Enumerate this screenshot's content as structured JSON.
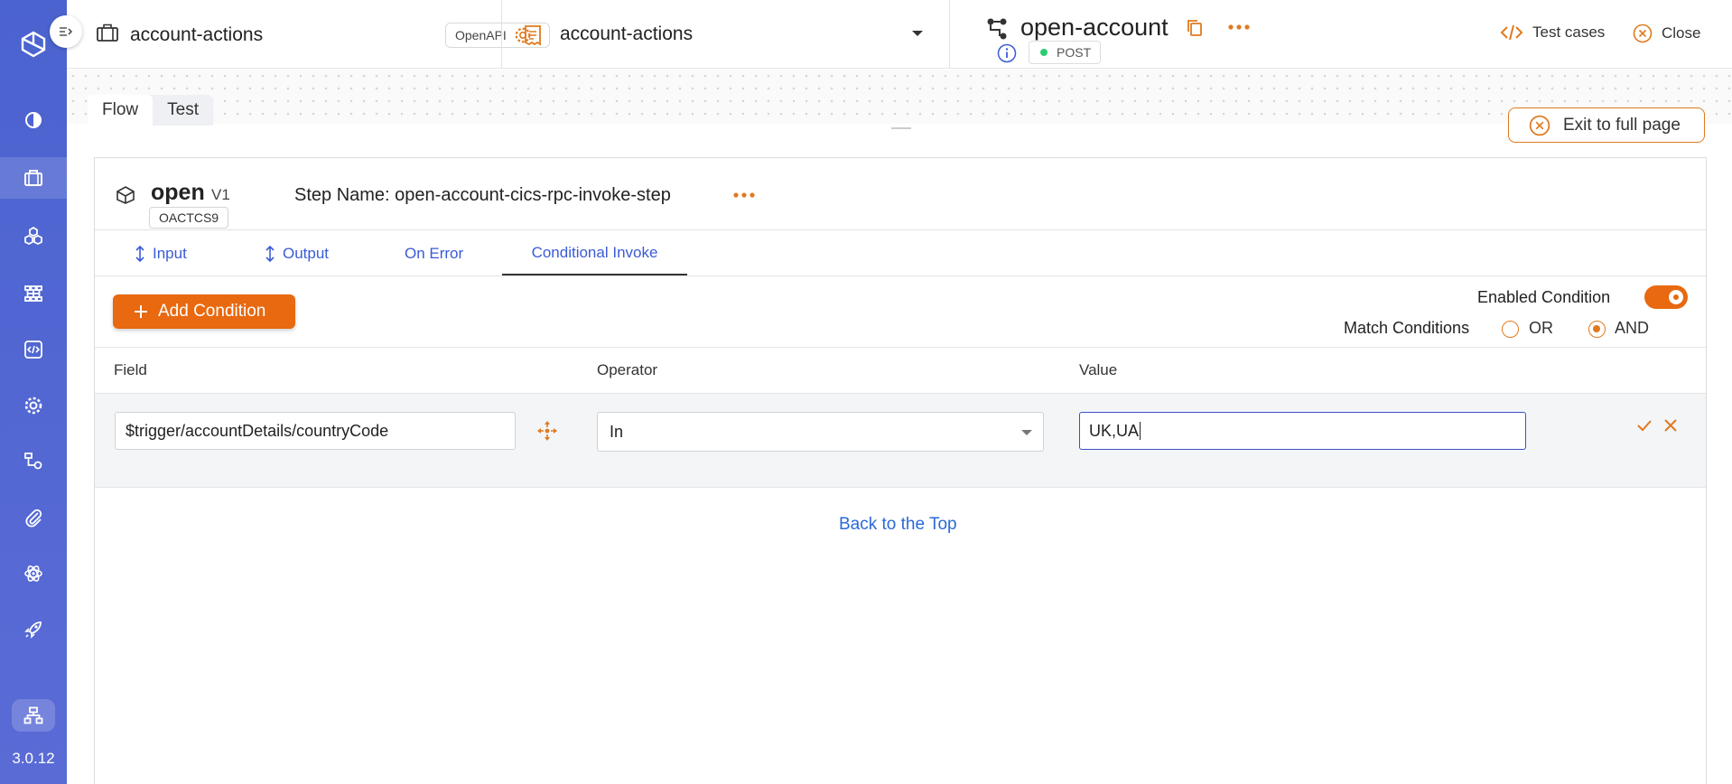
{
  "sidebar": {
    "items": [
      {
        "icon": "dashboard-icon"
      },
      {
        "icon": "briefcase-icon"
      },
      {
        "icon": "cubes-icon"
      },
      {
        "icon": "workflow-icon"
      },
      {
        "icon": "code-icon"
      },
      {
        "icon": "gear-icon"
      },
      {
        "icon": "flow-icon"
      },
      {
        "icon": "paperclip-icon"
      },
      {
        "icon": "atom-icon"
      },
      {
        "icon": "rocket-icon"
      }
    ],
    "bottom_icon": "sitemap-icon",
    "version": "3.0.12"
  },
  "header": {
    "project_title": "account-actions",
    "openapi_badge": "OpenAPI",
    "api_group_title": "account-actions",
    "api_title": "open-account",
    "method": "POST",
    "test_cases_label": "Test cases",
    "close_label": "Close"
  },
  "canvas": {
    "tabs": [
      "Flow",
      "Test"
    ],
    "active_tab": "Flow",
    "exit_full_page": "Exit to full page"
  },
  "step": {
    "name": "open",
    "version": "V1",
    "code": "OACTCS9",
    "label": "Step Name: open-account-cics-rpc-invoke-step"
  },
  "tabs": [
    {
      "label": "Input",
      "icon": "updown-arrow-icon"
    },
    {
      "label": "Output",
      "icon": "updown-arrow-icon"
    },
    {
      "label": "On Error"
    },
    {
      "label": "Conditional Invoke"
    }
  ],
  "active_tab": "Conditional Invoke",
  "conditions": {
    "add_label": "Add Condition",
    "enabled_label": "Enabled Condition",
    "enabled": true,
    "match_label": "Match Conditions",
    "options": [
      "OR",
      "AND"
    ],
    "selected": "AND",
    "columns": [
      "Field",
      "Operator",
      "Value"
    ],
    "rows": [
      {
        "field": "$trigger/accountDetails/countryCode",
        "operator": "In",
        "value": "UK,UA"
      }
    ],
    "back_to_top": "Back to the Top"
  },
  "colors": {
    "sidebar": "#4b63cf",
    "accent": "#e8690f",
    "link": "#3b5bd6"
  }
}
